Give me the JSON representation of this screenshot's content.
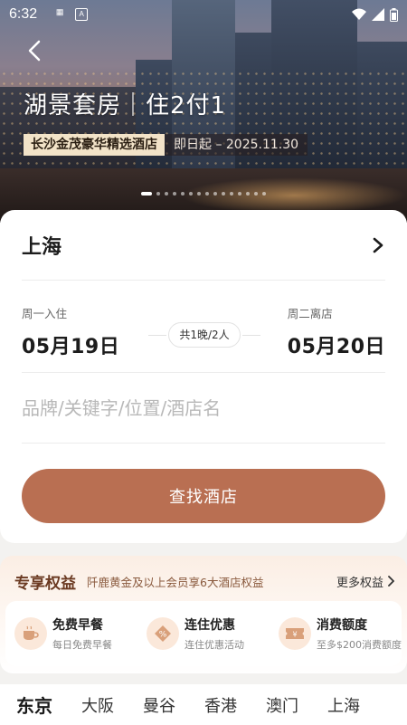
{
  "status": {
    "time": "6:32",
    "left_icons": [
      "app-icon-1",
      "app-icon-2"
    ],
    "right_icons": [
      "wifi-icon",
      "signal-icon",
      "battery-icon"
    ]
  },
  "hero": {
    "title": "湖景套房｜住2付1",
    "hotel_name": "长沙金茂豪华精选酒店",
    "date_text": "即日起 – 2025.11.30",
    "pager": {
      "count": 15,
      "active": 0
    }
  },
  "search": {
    "city": "上海",
    "checkin_label": "周一入住",
    "checkin_date": "05月19日",
    "checkout_label": "周二离店",
    "checkout_date": "05月20日",
    "nights_guests": "共1晚/2人",
    "keyword_placeholder": "品牌/关键字/位置/酒店名",
    "search_button": "查找酒店"
  },
  "benefits": {
    "title": "专享权益",
    "description": "阡鹿黄金及以上会员享6大酒店权益",
    "more": "更多权益",
    "items": [
      {
        "name": "免费早餐",
        "sub": "每日免费早餐",
        "icon": "coffee-icon"
      },
      {
        "name": "连住优惠",
        "sub": "连住优惠活动",
        "icon": "discount-icon"
      },
      {
        "name": "消费额度",
        "sub": "至多$200消费额度",
        "icon": "voucher-icon"
      }
    ]
  },
  "city_tabs": [
    "东京",
    "大阪",
    "曼谷",
    "香港",
    "澳门",
    "上海"
  ],
  "colors": {
    "primary": "#b96f52",
    "benefit_title": "#6b3a22",
    "tag_bg": "#f2e3c8"
  }
}
